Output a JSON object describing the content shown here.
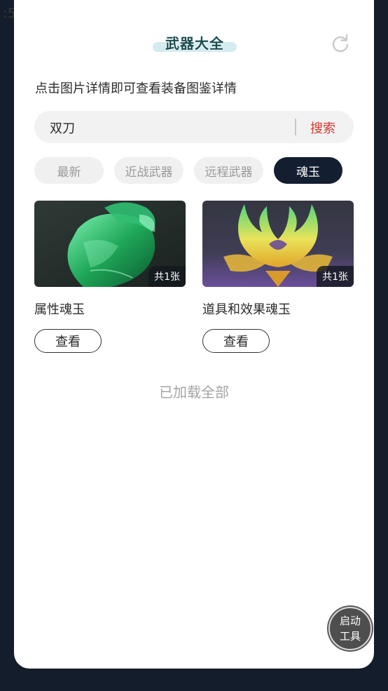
{
  "status": {
    "time": ":55"
  },
  "header": {
    "title": "武器大全"
  },
  "hint": "点击图片详情即可查看装备图鉴详情",
  "search": {
    "value": "双刀",
    "button_label": "搜索"
  },
  "tabs": [
    {
      "label": "最新"
    },
    {
      "label": "近战武器"
    },
    {
      "label": "远程武器"
    },
    {
      "label": "魂玉",
      "active": true
    }
  ],
  "items": [
    {
      "name": "属性魂玉",
      "count": "共1张",
      "button_label": "查看",
      "image_icon": "green-jade-pendant"
    },
    {
      "name": "道具和效果魂玉",
      "count": "共1张",
      "button_label": "查看",
      "image_icon": "golden-flame-jade"
    }
  ],
  "footer": {
    "loaded_text": "已加载全部"
  },
  "fab": {
    "line1": "启动",
    "line2": "工具"
  },
  "colors": {
    "accent_red": "#d9362b",
    "active_tab": "#131e30",
    "background": "#141d2b"
  }
}
